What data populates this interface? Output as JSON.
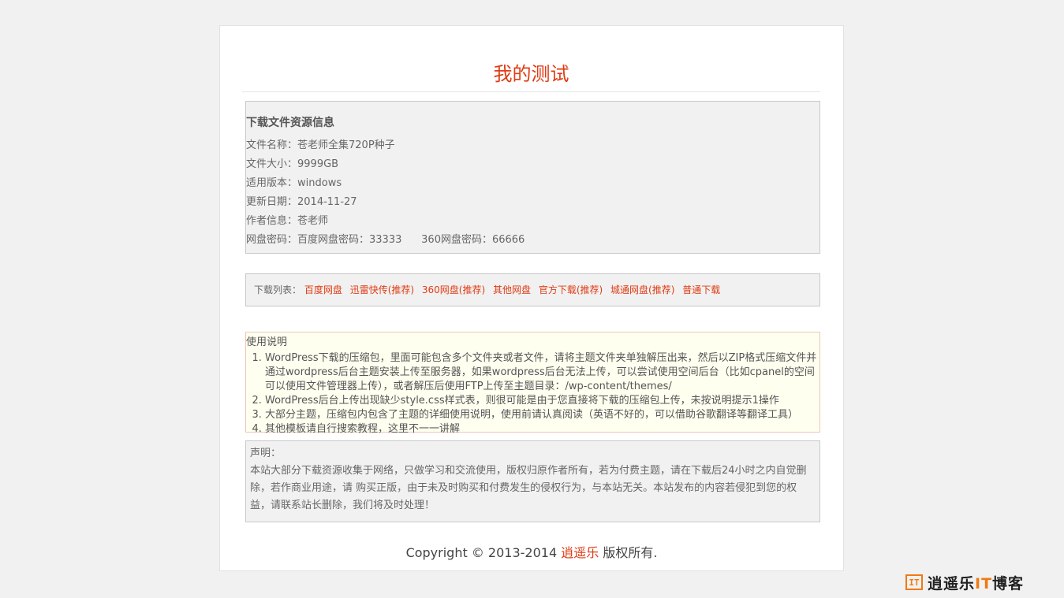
{
  "title": "我的测试",
  "info": {
    "heading": "下载文件资源信息",
    "rows": [
      "文件名称：苍老师全集720P种子",
      "文件大小：9999GB",
      "适用版本：windows",
      "更新日期：2014-11-27",
      "作者信息：苍老师",
      "网盘密码：百度网盘密码：33333      360网盘密码：66666"
    ]
  },
  "downloads": {
    "label": "下载列表：",
    "links": [
      "百度网盘",
      "迅雷快传(推荐)",
      "360网盘(推荐)",
      "其他网盘",
      "官方下载(推荐)",
      "城通网盘(推荐)",
      "普通下载"
    ]
  },
  "usage": {
    "heading": "使用说明",
    "items": [
      "WordPress下载的压缩包，里面可能包含多个文件夹或者文件，请将主题文件夹单独解压出来，然后以ZIP格式压缩文件并通过wordpress后台主题安装上传至服务器，如果wordpress后台无法上传，可以尝试使用空间后台（比如cpanel的空间可以使用文件管理器上传），或者解压后使用FTP上传至主题目录：/wp-content/themes/",
      "WordPress后台上传出现缺少style.css样式表，则很可能是由于您直接将下载的压缩包上传，未按说明提示1操作",
      "大部分主题，压缩包内包含了主题的详细使用说明，使用前请认真阅读（英语不好的，可以借助谷歌翻译等翻译工具）",
      "其他模板请自行搜索教程，这里不一一讲解"
    ]
  },
  "notice": {
    "title": "声明：",
    "body": "本站大部分下载资源收集于网络，只做学习和交流使用，版权归原作者所有，若为付费主题，请在下载后24小时之内自觉删除，若作商业用途，请 购买正版，由于未及时购买和付费发生的侵权行为，与本站无关。本站发布的内容若侵犯到您的权益，请联系站长删除，我们将及时处理！"
  },
  "footer": {
    "prefix": "Copyright © 2013-2014 ",
    "site": "逍遥乐",
    "suffix": " 版权所有."
  },
  "watermark": {
    "mark": "IT",
    "text_a": "逍遥乐",
    "text_b": "IT",
    "text_c": "博客"
  },
  "colors": {
    "accent": "#e03b14",
    "background": "#f1f1f1",
    "brand_orange": "#f07a12"
  }
}
